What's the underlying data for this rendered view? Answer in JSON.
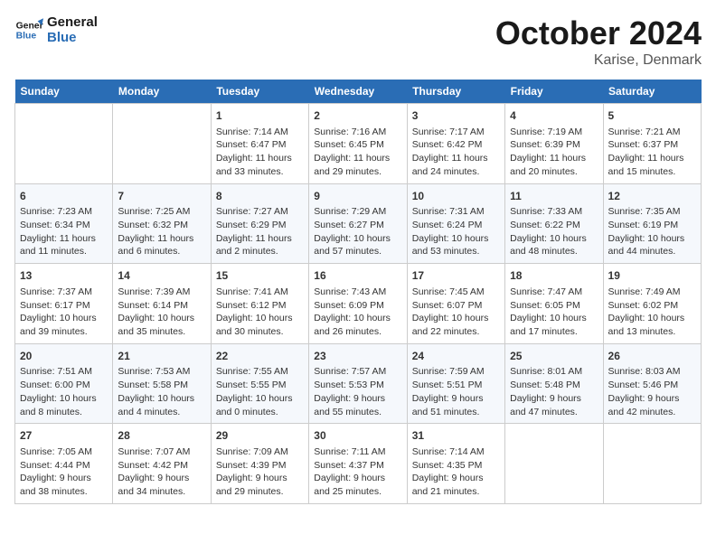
{
  "header": {
    "logo_line1": "General",
    "logo_line2": "Blue",
    "title": "October 2024",
    "subtitle": "Karise, Denmark"
  },
  "columns": [
    "Sunday",
    "Monday",
    "Tuesday",
    "Wednesday",
    "Thursday",
    "Friday",
    "Saturday"
  ],
  "weeks": [
    [
      {
        "day": "",
        "info": ""
      },
      {
        "day": "",
        "info": ""
      },
      {
        "day": "1",
        "info": "Sunrise: 7:14 AM\nSunset: 6:47 PM\nDaylight: 11 hours\nand 33 minutes."
      },
      {
        "day": "2",
        "info": "Sunrise: 7:16 AM\nSunset: 6:45 PM\nDaylight: 11 hours\nand 29 minutes."
      },
      {
        "day": "3",
        "info": "Sunrise: 7:17 AM\nSunset: 6:42 PM\nDaylight: 11 hours\nand 24 minutes."
      },
      {
        "day": "4",
        "info": "Sunrise: 7:19 AM\nSunset: 6:39 PM\nDaylight: 11 hours\nand 20 minutes."
      },
      {
        "day": "5",
        "info": "Sunrise: 7:21 AM\nSunset: 6:37 PM\nDaylight: 11 hours\nand 15 minutes."
      }
    ],
    [
      {
        "day": "6",
        "info": "Sunrise: 7:23 AM\nSunset: 6:34 PM\nDaylight: 11 hours\nand 11 minutes."
      },
      {
        "day": "7",
        "info": "Sunrise: 7:25 AM\nSunset: 6:32 PM\nDaylight: 11 hours\nand 6 minutes."
      },
      {
        "day": "8",
        "info": "Sunrise: 7:27 AM\nSunset: 6:29 PM\nDaylight: 11 hours\nand 2 minutes."
      },
      {
        "day": "9",
        "info": "Sunrise: 7:29 AM\nSunset: 6:27 PM\nDaylight: 10 hours\nand 57 minutes."
      },
      {
        "day": "10",
        "info": "Sunrise: 7:31 AM\nSunset: 6:24 PM\nDaylight: 10 hours\nand 53 minutes."
      },
      {
        "day": "11",
        "info": "Sunrise: 7:33 AM\nSunset: 6:22 PM\nDaylight: 10 hours\nand 48 minutes."
      },
      {
        "day": "12",
        "info": "Sunrise: 7:35 AM\nSunset: 6:19 PM\nDaylight: 10 hours\nand 44 minutes."
      }
    ],
    [
      {
        "day": "13",
        "info": "Sunrise: 7:37 AM\nSunset: 6:17 PM\nDaylight: 10 hours\nand 39 minutes."
      },
      {
        "day": "14",
        "info": "Sunrise: 7:39 AM\nSunset: 6:14 PM\nDaylight: 10 hours\nand 35 minutes."
      },
      {
        "day": "15",
        "info": "Sunrise: 7:41 AM\nSunset: 6:12 PM\nDaylight: 10 hours\nand 30 minutes."
      },
      {
        "day": "16",
        "info": "Sunrise: 7:43 AM\nSunset: 6:09 PM\nDaylight: 10 hours\nand 26 minutes."
      },
      {
        "day": "17",
        "info": "Sunrise: 7:45 AM\nSunset: 6:07 PM\nDaylight: 10 hours\nand 22 minutes."
      },
      {
        "day": "18",
        "info": "Sunrise: 7:47 AM\nSunset: 6:05 PM\nDaylight: 10 hours\nand 17 minutes."
      },
      {
        "day": "19",
        "info": "Sunrise: 7:49 AM\nSunset: 6:02 PM\nDaylight: 10 hours\nand 13 minutes."
      }
    ],
    [
      {
        "day": "20",
        "info": "Sunrise: 7:51 AM\nSunset: 6:00 PM\nDaylight: 10 hours\nand 8 minutes."
      },
      {
        "day": "21",
        "info": "Sunrise: 7:53 AM\nSunset: 5:58 PM\nDaylight: 10 hours\nand 4 minutes."
      },
      {
        "day": "22",
        "info": "Sunrise: 7:55 AM\nSunset: 5:55 PM\nDaylight: 10 hours\nand 0 minutes."
      },
      {
        "day": "23",
        "info": "Sunrise: 7:57 AM\nSunset: 5:53 PM\nDaylight: 9 hours\nand 55 minutes."
      },
      {
        "day": "24",
        "info": "Sunrise: 7:59 AM\nSunset: 5:51 PM\nDaylight: 9 hours\nand 51 minutes."
      },
      {
        "day": "25",
        "info": "Sunrise: 8:01 AM\nSunset: 5:48 PM\nDaylight: 9 hours\nand 47 minutes."
      },
      {
        "day": "26",
        "info": "Sunrise: 8:03 AM\nSunset: 5:46 PM\nDaylight: 9 hours\nand 42 minutes."
      }
    ],
    [
      {
        "day": "27",
        "info": "Sunrise: 7:05 AM\nSunset: 4:44 PM\nDaylight: 9 hours\nand 38 minutes."
      },
      {
        "day": "28",
        "info": "Sunrise: 7:07 AM\nSunset: 4:42 PM\nDaylight: 9 hours\nand 34 minutes."
      },
      {
        "day": "29",
        "info": "Sunrise: 7:09 AM\nSunset: 4:39 PM\nDaylight: 9 hours\nand 29 minutes."
      },
      {
        "day": "30",
        "info": "Sunrise: 7:11 AM\nSunset: 4:37 PM\nDaylight: 9 hours\nand 25 minutes."
      },
      {
        "day": "31",
        "info": "Sunrise: 7:14 AM\nSunset: 4:35 PM\nDaylight: 9 hours\nand 21 minutes."
      },
      {
        "day": "",
        "info": ""
      },
      {
        "day": "",
        "info": ""
      }
    ]
  ]
}
